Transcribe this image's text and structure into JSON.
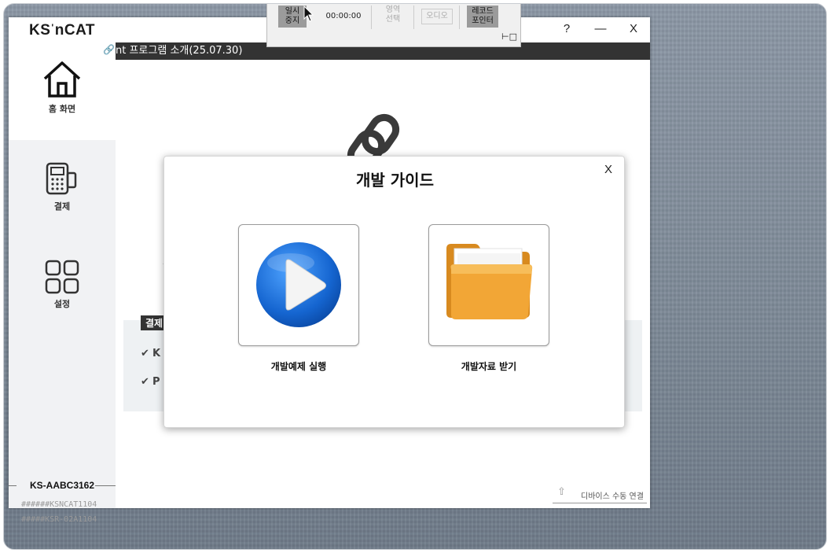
{
  "app": {
    "logo": {
      "left": "KS",
      "right": "nCAT"
    },
    "window_controls": {
      "help": "?",
      "minimize": "—",
      "close": "X"
    },
    "top_bar_text": "nt 프로그램 소개(25.07.30)"
  },
  "sidebar": {
    "items": [
      {
        "label": "홈 화면",
        "icon": "home-icon"
      },
      {
        "label": "결제",
        "icon": "payment-terminal-icon"
      },
      {
        "label": "설정",
        "icon": "grid-icon"
      }
    ],
    "terminal_id": "KS-AABC3162",
    "versions": [
      "######KSNCAT1104",
      "#####KSR-02A1104"
    ]
  },
  "background_content": {
    "payment_tag": "결제",
    "items": [
      "K",
      "P"
    ],
    "x_glyph": "X"
  },
  "device_link": {
    "label": "디바이스 수동 연결"
  },
  "recorder": {
    "pause": "일시\n중지",
    "time": "00:00:00",
    "area_select": "영역\n선택",
    "audio": "오디오",
    "record_pointer": "레코드\n포인터"
  },
  "modal": {
    "title": "개발 가이드",
    "close": "X",
    "cards": [
      {
        "label": "개발예제 실행",
        "icon": "play-icon"
      },
      {
        "label": "개발자료 받기",
        "icon": "folder-icon"
      }
    ]
  },
  "colors": {
    "accent_blue": "#1e73d8",
    "folder_orange": "#f0a43a",
    "dark_bar": "#333333"
  }
}
